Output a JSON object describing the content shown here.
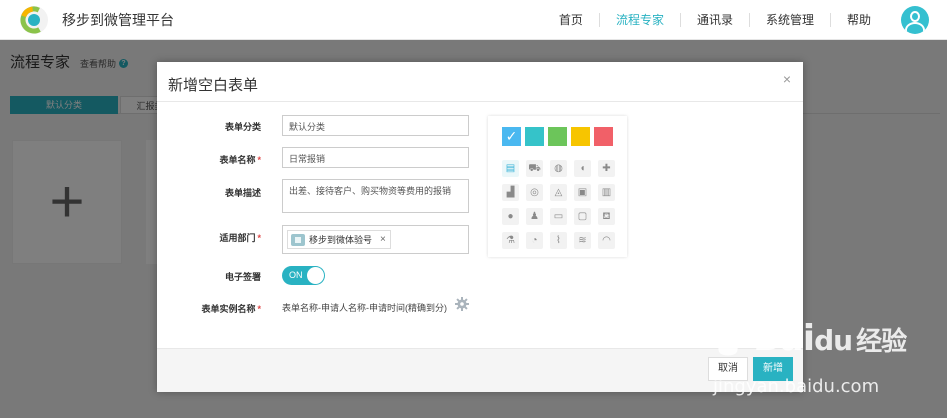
{
  "topbar": {
    "brand": "移步到微管理平台",
    "nav": [
      "首页",
      "流程专家",
      "通讯录",
      "系统管理",
      "帮助"
    ],
    "active_index": 1,
    "accent": "#29b2c2"
  },
  "page": {
    "title": "流程专家",
    "help": "查看帮助",
    "tabs": [
      "默认分类",
      "汇报类"
    ],
    "add_symbol": "+"
  },
  "modal": {
    "title": "新增空白表单",
    "close": "×",
    "fields": {
      "category": {
        "label": "表单分类",
        "value": "默认分类"
      },
      "name": {
        "label": "表单名称",
        "required": "*",
        "value": "日常报销"
      },
      "desc": {
        "label": "表单描述",
        "value": "出差、接待客户、购买物资等费用的报销"
      },
      "dept": {
        "label": "适用部门",
        "required": "*",
        "tag": "移步到微体验号",
        "remove": "×"
      },
      "signature": {
        "label": "电子签署",
        "toggle": "ON"
      },
      "instance": {
        "label": "表单实例名称",
        "required": "*",
        "value": "表单名称-申请人名称-申请时间(精确到分)"
      }
    },
    "colors": [
      "#4ab8f0",
      "#35c3c9",
      "#6cc55a",
      "#f7c500",
      "#f16068"
    ],
    "selected_color_index": 0,
    "check": "✓",
    "icons": [
      "document-icon",
      "truck-icon",
      "basketball-icon",
      "balloon-icon",
      "medical-kit-icon",
      "factory-icon",
      "globe-icon",
      "handshake-icon",
      "badge-icon",
      "book-icon",
      "person-icon",
      "presenter-icon",
      "credit-card-icon",
      "cash-icon",
      "cart-icon",
      "microscope-icon",
      "pie-chart-icon",
      "line-chart-icon",
      "coins-icon",
      "speedometer-icon"
    ],
    "icon_glyphs": [
      "▤",
      "⛟",
      "◍",
      "◖",
      "✚",
      "▟",
      "◎",
      "◬",
      "▣",
      "▥",
      "●",
      "♟",
      "▭",
      "▢",
      "⛾",
      "⚗",
      "◔",
      "⌇",
      "≋",
      "◠"
    ],
    "cancel": "取消",
    "create": "新增"
  },
  "watermark": {
    "brand": "Bai",
    "suffix": "经验",
    "url": "jingyan.baidu.com"
  }
}
